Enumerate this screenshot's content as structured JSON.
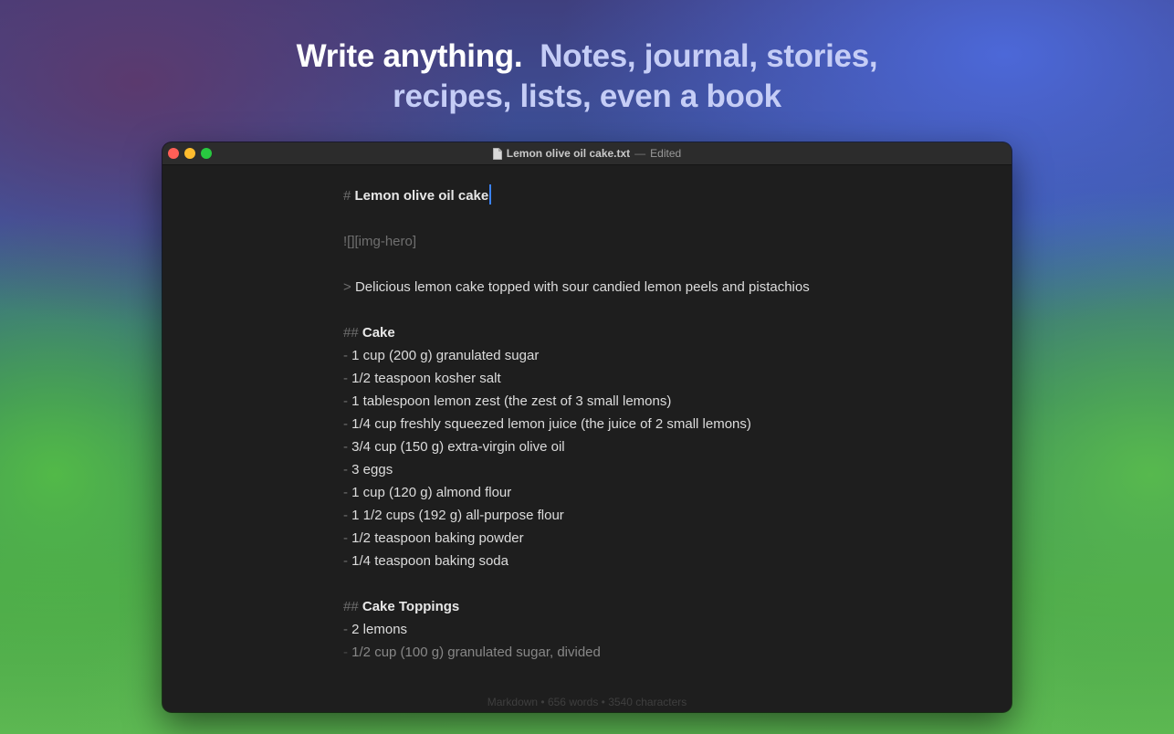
{
  "headline": {
    "strong": "Write anything.",
    "soft_line1": "Notes, journal, stories,",
    "soft_line2": "recipes, lists, even a book"
  },
  "window": {
    "filename": "Lemon olive oil cake.txt",
    "separator": "—",
    "state": "Edited"
  },
  "document": {
    "h1_marker": "#",
    "title": "Lemon olive oil cake",
    "image_ref": "![][img-hero]",
    "quote_marker": ">",
    "quote": "Delicious lemon cake topped with sour candied lemon peels and pistachios",
    "h2_marker": "##",
    "section1_title": "Cake",
    "list_marker": "-",
    "section1_items": [
      "1 cup (200 g) granulated sugar",
      "1/2 teaspoon kosher salt",
      "1 tablespoon lemon zest (the zest of 3 small lemons)",
      "1/4 cup freshly squeezed lemon juice (the juice of 2 small lemons)",
      "3/4 cup (150 g) extra-virgin olive oil",
      "3 eggs",
      "1 cup (120 g) almond flour",
      "1 1/2 cups (192 g) all-purpose flour",
      "1/2 teaspoon baking powder",
      "1/4 teaspoon baking soda"
    ],
    "section2_title": "Cake Toppings",
    "section2_items": [
      "2 lemons",
      "1/2 cup (100 g) granulated sugar, divided"
    ]
  },
  "status": {
    "text": "Markdown • 656 words • 3540 characters"
  },
  "colors": {
    "caret": "#3b82f6",
    "close": "#fe5f57",
    "minimize": "#febc2e",
    "maximize": "#28c840"
  },
  "icons": [
    "document-icon"
  ]
}
